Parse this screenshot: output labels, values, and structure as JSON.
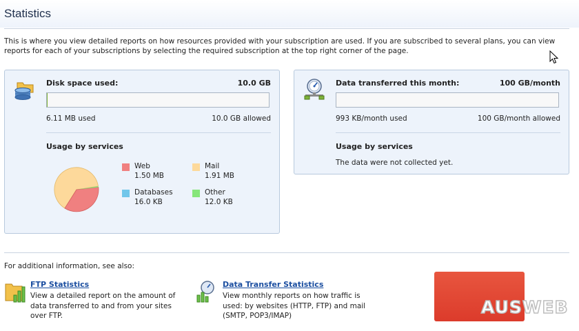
{
  "page": {
    "title": "Statistics",
    "intro": "This is where you view detailed reports on how resources provided with your subscription are used. If you are subscribed to several plans, you can view reports for each of your subscriptions by selecting the required subscription at the top right corner of the page."
  },
  "disk": {
    "label": "Disk space used:",
    "value": "10.0 GB",
    "used": "6.11 MB used",
    "allowed": "10.0 GB allowed",
    "usage_fraction": 0.0006,
    "usage_heading": "Usage by services",
    "legend": [
      {
        "name": "Web",
        "value": "1.50 MB",
        "color": "#f08080"
      },
      {
        "name": "Mail",
        "value": "1.91 MB",
        "color": "#fdd99b"
      },
      {
        "name": "Databases",
        "value": "16.0 KB",
        "color": "#71c6ea"
      },
      {
        "name": "Other",
        "value": "12.0 KB",
        "color": "#86e67a"
      }
    ]
  },
  "transfer": {
    "label": "Data transferred this month:",
    "value": "100 GB/month",
    "used": "993 KB/month used",
    "allowed": "100 GB/month allowed",
    "usage_fraction": 0.0,
    "usage_heading": "Usage by services",
    "no_data": "The data were not collected yet."
  },
  "see_also": {
    "heading": "For additional information, see also:",
    "links": [
      {
        "title": "FTP Statistics",
        "description": "View a detailed report on the amount of data transferred to and from your sites over FTP."
      },
      {
        "title": "Data Transfer Statistics",
        "description": "View monthly reports on how traffic is used: by websites (HTTP, FTP) and mail (SMTP, POP3/IMAP)"
      }
    ]
  },
  "logo": {
    "text": "AUSWEB"
  },
  "icons": {
    "disk": "database-folder-icon",
    "transfer": "network-gauge-icon",
    "ftp": "folder-chart-icon",
    "traffic": "gauge-chart-icon",
    "cursor": "mouse-pointer-icon"
  }
}
